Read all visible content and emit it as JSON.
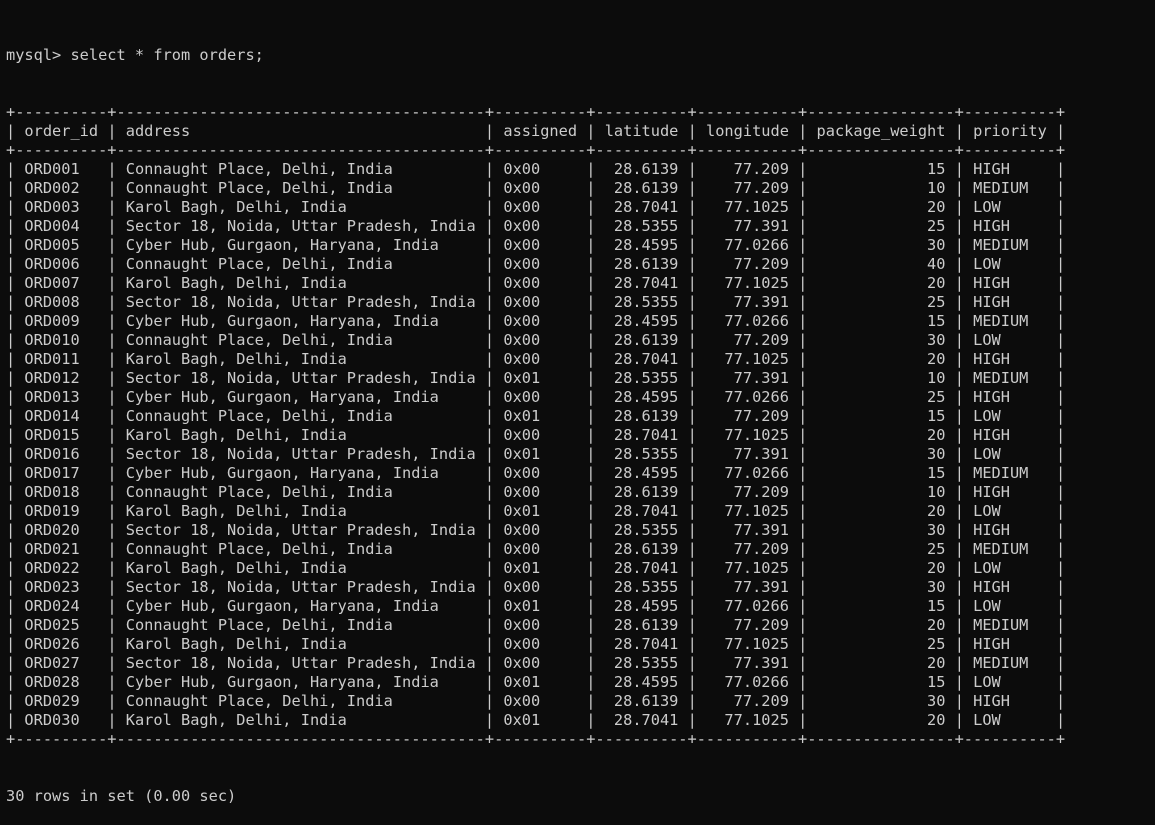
{
  "terminal": {
    "prompt": "mysql> ",
    "command": "select * from orders;",
    "footer": "30 rows in set (0.00 sec)",
    "colors": {
      "background": "#0c0c0c",
      "text": "#cccccc"
    }
  },
  "table": {
    "columns": [
      "order_id",
      "address",
      "assigned",
      "latitude",
      "longitude",
      "package_weight",
      "priority"
    ],
    "align": [
      "left",
      "left",
      "left",
      "right",
      "right",
      "right",
      "left"
    ],
    "rows": [
      [
        "ORD001",
        "Connaught Place, Delhi, India",
        "0x00",
        "28.6139",
        "77.209",
        "15",
        "HIGH"
      ],
      [
        "ORD002",
        "Connaught Place, Delhi, India",
        "0x00",
        "28.6139",
        "77.209",
        "10",
        "MEDIUM"
      ],
      [
        "ORD003",
        "Karol Bagh, Delhi, India",
        "0x00",
        "28.7041",
        "77.1025",
        "20",
        "LOW"
      ],
      [
        "ORD004",
        "Sector 18, Noida, Uttar Pradesh, India",
        "0x00",
        "28.5355",
        "77.391",
        "25",
        "HIGH"
      ],
      [
        "ORD005",
        "Cyber Hub, Gurgaon, Haryana, India",
        "0x00",
        "28.4595",
        "77.0266",
        "30",
        "MEDIUM"
      ],
      [
        "ORD006",
        "Connaught Place, Delhi, India",
        "0x00",
        "28.6139",
        "77.209",
        "40",
        "LOW"
      ],
      [
        "ORD007",
        "Karol Bagh, Delhi, India",
        "0x00",
        "28.7041",
        "77.1025",
        "20",
        "HIGH"
      ],
      [
        "ORD008",
        "Sector 18, Noida, Uttar Pradesh, India",
        "0x00",
        "28.5355",
        "77.391",
        "25",
        "HIGH"
      ],
      [
        "ORD009",
        "Cyber Hub, Gurgaon, Haryana, India",
        "0x00",
        "28.4595",
        "77.0266",
        "15",
        "MEDIUM"
      ],
      [
        "ORD010",
        "Connaught Place, Delhi, India",
        "0x00",
        "28.6139",
        "77.209",
        "30",
        "LOW"
      ],
      [
        "ORD011",
        "Karol Bagh, Delhi, India",
        "0x00",
        "28.7041",
        "77.1025",
        "20",
        "HIGH"
      ],
      [
        "ORD012",
        "Sector 18, Noida, Uttar Pradesh, India",
        "0x01",
        "28.5355",
        "77.391",
        "10",
        "MEDIUM"
      ],
      [
        "ORD013",
        "Cyber Hub, Gurgaon, Haryana, India",
        "0x00",
        "28.4595",
        "77.0266",
        "25",
        "HIGH"
      ],
      [
        "ORD014",
        "Connaught Place, Delhi, India",
        "0x01",
        "28.6139",
        "77.209",
        "15",
        "LOW"
      ],
      [
        "ORD015",
        "Karol Bagh, Delhi, India",
        "0x00",
        "28.7041",
        "77.1025",
        "20",
        "HIGH"
      ],
      [
        "ORD016",
        "Sector 18, Noida, Uttar Pradesh, India",
        "0x01",
        "28.5355",
        "77.391",
        "30",
        "LOW"
      ],
      [
        "ORD017",
        "Cyber Hub, Gurgaon, Haryana, India",
        "0x00",
        "28.4595",
        "77.0266",
        "15",
        "MEDIUM"
      ],
      [
        "ORD018",
        "Connaught Place, Delhi, India",
        "0x00",
        "28.6139",
        "77.209",
        "10",
        "HIGH"
      ],
      [
        "ORD019",
        "Karol Bagh, Delhi, India",
        "0x01",
        "28.7041",
        "77.1025",
        "20",
        "LOW"
      ],
      [
        "ORD020",
        "Sector 18, Noida, Uttar Pradesh, India",
        "0x00",
        "28.5355",
        "77.391",
        "30",
        "HIGH"
      ],
      [
        "ORD021",
        "Connaught Place, Delhi, India",
        "0x00",
        "28.6139",
        "77.209",
        "25",
        "MEDIUM"
      ],
      [
        "ORD022",
        "Karol Bagh, Delhi, India",
        "0x01",
        "28.7041",
        "77.1025",
        "20",
        "LOW"
      ],
      [
        "ORD023",
        "Sector 18, Noida, Uttar Pradesh, India",
        "0x00",
        "28.5355",
        "77.391",
        "30",
        "HIGH"
      ],
      [
        "ORD024",
        "Cyber Hub, Gurgaon, Haryana, India",
        "0x01",
        "28.4595",
        "77.0266",
        "15",
        "LOW"
      ],
      [
        "ORD025",
        "Connaught Place, Delhi, India",
        "0x00",
        "28.6139",
        "77.209",
        "20",
        "MEDIUM"
      ],
      [
        "ORD026",
        "Karol Bagh, Delhi, India",
        "0x00",
        "28.7041",
        "77.1025",
        "25",
        "HIGH"
      ],
      [
        "ORD027",
        "Sector 18, Noida, Uttar Pradesh, India",
        "0x00",
        "28.5355",
        "77.391",
        "20",
        "MEDIUM"
      ],
      [
        "ORD028",
        "Cyber Hub, Gurgaon, Haryana, India",
        "0x01",
        "28.4595",
        "77.0266",
        "15",
        "LOW"
      ],
      [
        "ORD029",
        "Connaught Place, Delhi, India",
        "0x00",
        "28.6139",
        "77.209",
        "30",
        "HIGH"
      ],
      [
        "ORD030",
        "Karol Bagh, Delhi, India",
        "0x01",
        "28.7041",
        "77.1025",
        "20",
        "LOW"
      ]
    ]
  }
}
